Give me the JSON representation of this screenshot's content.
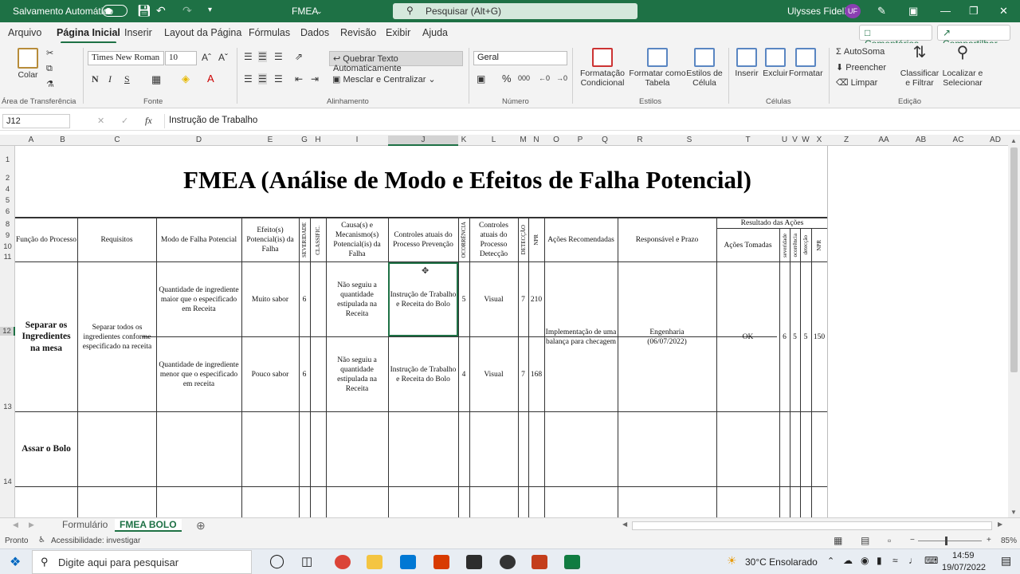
{
  "titlebar": {
    "autosave": "Salvamento Automático",
    "doc": "FMEA",
    "search": "Pesquisar (Alt+G)",
    "user": "Ulysses Fidelis",
    "initials": "UF"
  },
  "menu": {
    "tabs": [
      "Arquivo",
      "Página Inicial",
      "Inserir",
      "Layout da Página",
      "Fórmulas",
      "Dados",
      "Revisão",
      "Exibir",
      "Ajuda"
    ],
    "comments": "Comentários",
    "share": "Compartilhar"
  },
  "ribbon": {
    "paste": "Colar",
    "clipboard": "Área de Transferência",
    "font_name": "Times New Roman",
    "font_size": "10",
    "font": "Fonte",
    "wrap": "Quebrar Texto Automaticamente",
    "merge": "Mesclar e Centralizar",
    "alignment": "Alinhamento",
    "number_format": "Geral",
    "number": "Número",
    "cond_fmt": "Formatação Condicional",
    "fmt_table": "Formatar como Tabela",
    "cell_styles": "Estilos de Célula",
    "styles": "Estilos",
    "insert": "Inserir",
    "delete": "Excluir",
    "format": "Formatar",
    "cells": "Células",
    "autosum": "AutoSoma",
    "fill": "Preencher",
    "clear": "Limpar",
    "sort": "Classificar e Filtrar",
    "find": "Localizar e Selecionar",
    "editing": "Edição"
  },
  "formula": {
    "namebox": "J12",
    "content": "Instrução de Trabalho"
  },
  "columns": [
    "A",
    "B",
    "C",
    "D",
    "E",
    "G",
    "H",
    "I",
    "J",
    "K",
    "L",
    "M",
    "N",
    "O",
    "P",
    "Q",
    "R",
    "S",
    "T",
    "U",
    "V",
    "W",
    "X",
    "Z",
    "AA",
    "AB",
    "AC",
    "AD"
  ],
  "rows": [
    "1",
    "2",
    "4",
    "5",
    "6",
    "8",
    "9",
    "10",
    "11",
    "12",
    "13",
    "14"
  ],
  "sheet": {
    "title": "FMEA (Análise de Modo e Efeitos de Falha Potencial)",
    "headers": {
      "funcao": "Função do Processo",
      "requisitos": "Requisitos",
      "modo": "Modo de Falha Potencial",
      "efeito": "Efeito(s) Potencial(is) da Falha",
      "severidade": "SEVERIDADE",
      "classif": "CLASSIFIC.",
      "causa": "Causa(s) e Mecanismo(s) Potencial(is) da Falha",
      "prevencao": "Controles atuais do Processo Prevenção",
      "ocorrencia": "OCORRÊNCIA",
      "deteccao_ctrl": "Controles atuais do Processo Detecção",
      "deteccao": "DETECÇÃO",
      "npr": "NPR",
      "acoes": "Ações Recomendadas",
      "responsavel": "Responsável e Prazo",
      "resultado": "Resultado das Ações",
      "acoes_tomadas": "Ações Tomadas",
      "r_sev": "severidade",
      "r_oco": "ocorrência",
      "r_det": "detecção",
      "r_npr": "NPR"
    },
    "step1": {
      "funcao": "Separar os Ingredientes na mesa",
      "requisitos": "Separar todos os ingredientes conforme especificado na receita",
      "acao": "Implementação de uma balança para checagem",
      "responsavel": "Engenharia (06/07/2022)",
      "tomada": "OK",
      "sev": "6",
      "oco": "5",
      "det": "5",
      "npr": "150"
    },
    "failures": [
      {
        "modo": "Quantidade de ingrediente maior que o especificado em Receita",
        "efeito": "Muito sabor",
        "sev": "6",
        "causa": "Não seguiu a quantidade estipulada na Receita",
        "prevencao": "Instrução de Trabalho e Receita do Bolo",
        "oco": "5",
        "deteccao": "Visual",
        "det": "7",
        "npr": "210"
      },
      {
        "modo": "Quantidade de ingrediente menor que o especificado em receita",
        "efeito": "Pouco sabor",
        "sev": "6",
        "causa": "Não seguiu a quantidade estipulada na Receita",
        "prevencao": "Instrução de Trabalho e Receita do Bolo",
        "oco": "4",
        "deteccao": "Visual",
        "det": "7",
        "npr": "168"
      }
    ],
    "step2": {
      "funcao": "Assar o Bolo"
    }
  },
  "tabs": [
    "Formulário",
    "FMEA BOLO"
  ],
  "status": {
    "ready": "Pronto",
    "accessibility": "Acessibilidade: investigar",
    "zoom": "85%"
  },
  "taskbar": {
    "search": "Digite aqui para pesquisar",
    "weather": "30°C Ensolarado",
    "time": "14:59",
    "date": "19/07/2022"
  },
  "colors": {
    "accent": "#1e7145"
  }
}
